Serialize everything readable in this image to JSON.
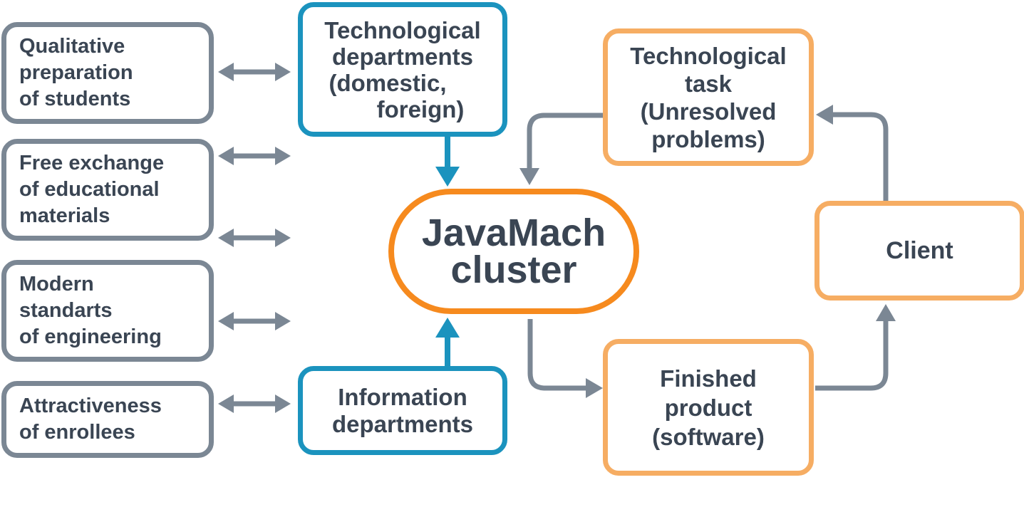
{
  "colors": {
    "gray_border": "#7b8794",
    "blue_border": "#1b93be",
    "orange_border": "#f6ad63",
    "cluster_border": "#f68a1e",
    "text": "#3a4553",
    "gray_arrow": "#7b8794",
    "blue_arrow": "#1b93be"
  },
  "left_boxes": {
    "qualitative": {
      "lines": [
        "Qualitative",
        "preparation",
        "of students"
      ]
    },
    "free_exchange": {
      "lines": [
        "Free exchange",
        "of educational",
        "materials"
      ]
    },
    "modern_standards": {
      "lines": [
        "Modern",
        "standarts",
        "of engineering"
      ]
    },
    "attractiveness": {
      "lines": [
        "Attractiveness",
        "of enrollees"
      ]
    }
  },
  "center": {
    "tech_departments": {
      "lines": [
        "Technological",
        "departments",
        "(domestic,",
        "foreign)"
      ]
    },
    "cluster": {
      "lines": [
        "JavaMach",
        "cluster"
      ]
    },
    "info_departments": {
      "lines": [
        "Information",
        "departments"
      ]
    }
  },
  "right": {
    "tech_task": {
      "lines": [
        "Technological",
        "task",
        "(Unresolved",
        "problems)"
      ]
    },
    "client": {
      "label": "Client"
    },
    "finished_product": {
      "lines": [
        "Finished",
        "product",
        "(software)"
      ]
    }
  },
  "icons": [
    "double-arrow-icon",
    "arrow-down-icon",
    "arrow-up-icon",
    "arrow-right-icon"
  ]
}
